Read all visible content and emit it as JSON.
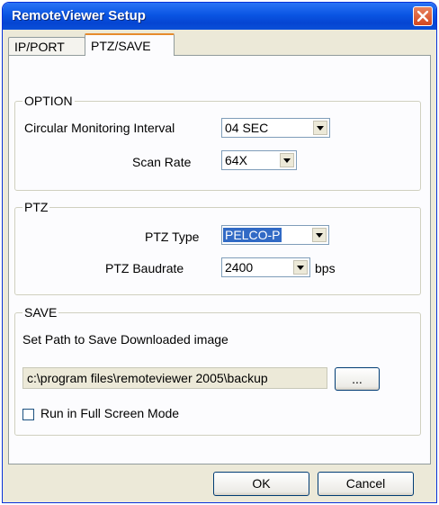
{
  "window": {
    "title": "RemoteViewer Setup"
  },
  "tabs": [
    {
      "label": "IP/PORT",
      "active": false
    },
    {
      "label": "PTZ/SAVE",
      "active": true
    }
  ],
  "option": {
    "title": "OPTION",
    "circular_label": "Circular Monitoring Interval",
    "circular_value": "04 SEC",
    "scan_label": "Scan Rate",
    "scan_value": "64X"
  },
  "ptz": {
    "title": "PTZ",
    "type_label": "PTZ Type",
    "type_value": "PELCO-P",
    "baud_label": "PTZ Baudrate",
    "baud_value": "2400",
    "baud_unit": "bps"
  },
  "save": {
    "title": "SAVE",
    "path_label": "Set Path to Save Downloaded image",
    "path_value": "c:\\program files\\remoteviewer 2005\\backup",
    "browse_label": "...",
    "fullscreen_label": "Run in Full Screen Mode",
    "fullscreen_checked": false
  },
  "buttons": {
    "ok": "OK",
    "cancel": "Cancel"
  },
  "colors": {
    "title_bar": "#0a55e3",
    "selection": "#316ac5",
    "close_button": "#d4461f",
    "tab_highlight": "#e68b2c"
  }
}
